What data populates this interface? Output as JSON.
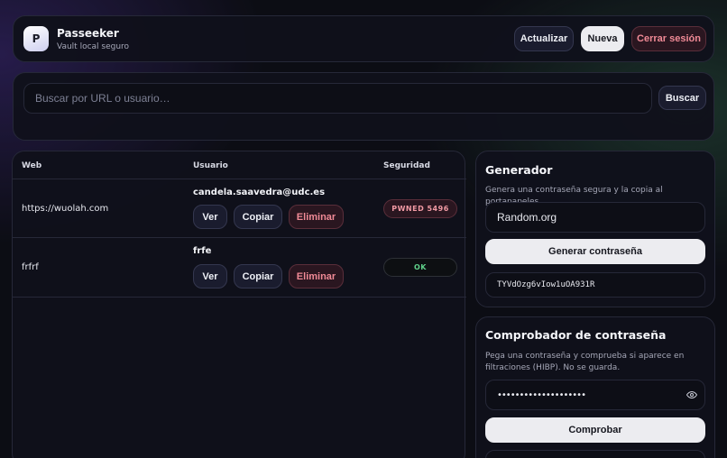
{
  "header": {
    "logo_letter": "P",
    "app_name": "Passeeker",
    "app_subtitle": "Vault local seguro",
    "refresh_label": "Actualizar",
    "new_label": "Nueva",
    "logout_label": "Cerrar sesión"
  },
  "search": {
    "placeholder": "Buscar por URL o usuario…",
    "value": "",
    "button_label": "Buscar"
  },
  "table": {
    "columns": [
      "Web",
      "Usuario",
      "Seguridad"
    ],
    "rows": [
      {
        "web": "https://wuolah.com",
        "user": "candela.saavedra@udc.es",
        "security": "PWNED 5496",
        "status": "pwned"
      },
      {
        "web": "frfrf",
        "user": "frfe",
        "security": "OK",
        "status": "ok"
      }
    ],
    "actions": {
      "view": "Ver",
      "copy": "Copiar",
      "delete": "Eliminar"
    }
  },
  "generator": {
    "title": "Generador",
    "description": "Genera una contraseña segura y la copia al portapapeles.",
    "source_value": "Random.org",
    "generate_label": "Generar contraseña",
    "output_value": "TYVdOzg6vIow1uOA931R"
  },
  "checker": {
    "title": "Comprobador de contraseña",
    "description": "Pega una contraseña y comprueba si aparece en filtraciones (HIBP). No se guarda.",
    "password_value": "••••••••••••••••••••",
    "check_label": "Comprobar"
  },
  "icons": {
    "eye": "eye-icon"
  },
  "colors": {
    "danger": "#f08a96",
    "ok": "#5fd18a",
    "light_button": "#ececf0",
    "panel": "#10111b"
  }
}
